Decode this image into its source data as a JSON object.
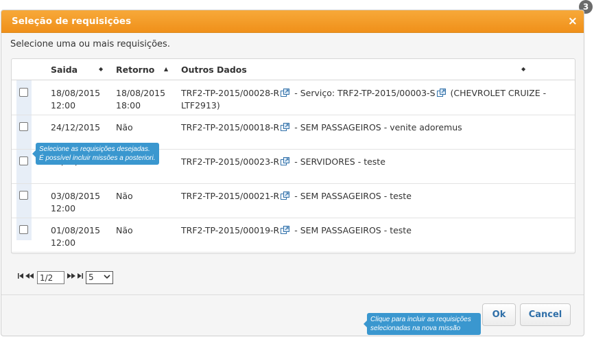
{
  "dialog": {
    "title": "Seleção de requisições",
    "close_icon": "×",
    "step_badge": "3",
    "intro": "Selecione uma ou mais requisições."
  },
  "table": {
    "headers": {
      "saida": "Saida",
      "retorno": "Retorno",
      "outros": "Outros Dados"
    },
    "sort_icons": {
      "saida": "◆",
      "retorno": "▲",
      "outros": "◆"
    },
    "rows": [
      {
        "saida_date": "18/08/2015",
        "saida_time": "12:00",
        "retorno_date": "18/08/2015",
        "retorno_time": "18:00",
        "code": "TRF2-TP-2015/00028-R",
        "mid": " - Serviço: TRF2-TP-2015/00003-S",
        "rest": " (CHEVROLET CRUIZE - LTF2913)"
      },
      {
        "saida_date": "24/12/2015",
        "saida_time": "",
        "retorno_date": "Não",
        "retorno_time": "",
        "code": "TRF2-TP-2015/00018-R",
        "rest": " - SEM PASSAGEIROS - venite adoremus"
      },
      {
        "saida_date": "14/08/2015",
        "saida_time": "",
        "retorno_date": "Não",
        "retorno_time": "",
        "code": "TRF2-TP-2015/00023-R",
        "rest": " - SERVIDORES - teste"
      },
      {
        "saida_date": "03/08/2015",
        "saida_time": "12:00",
        "retorno_date": "Não",
        "retorno_time": "",
        "code": "TRF2-TP-2015/00021-R",
        "rest": " - SEM PASSAGEIROS - teste"
      },
      {
        "saida_date": "01/08/2015",
        "saida_time": "12:00",
        "retorno_date": "Não",
        "retorno_time": "",
        "code": "TRF2-TP-2015/00019-R",
        "rest": " - SEM PASSAGEIROS - teste"
      }
    ]
  },
  "tooltips": {
    "checkbox_line1": "Selecione as requisições desejadas.",
    "checkbox_line2": "É possível incluir missões a posteriori.",
    "ok_line1": "Clique para incluir as  requisições",
    "ok_line2": "selecionadas na nova missão"
  },
  "pager": {
    "first": "⏮",
    "prev": "◀◀",
    "page_value": "1/2",
    "next": "▶▶",
    "last": "⏭",
    "page_size": "5"
  },
  "buttons": {
    "ok": "Ok",
    "cancel": "Cancel"
  },
  "colors": {
    "title_bar": "#f0901a",
    "tooltip": "#3a97cf",
    "button_text": "#2f6fa8"
  }
}
